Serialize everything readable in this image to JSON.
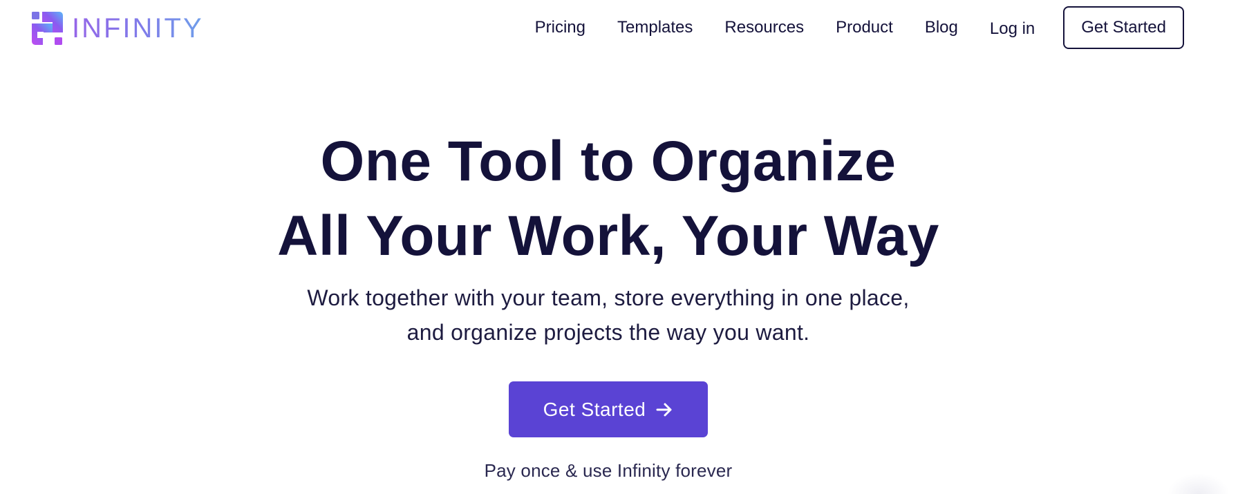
{
  "brand": {
    "name": "INFINITY",
    "icon": "infinity-logo-icon",
    "gradient": [
      "#c04cf0",
      "#8a5cf0",
      "#5ab8f8"
    ]
  },
  "nav": {
    "links": [
      {
        "label": "Pricing"
      },
      {
        "label": "Templates"
      },
      {
        "label": "Resources"
      },
      {
        "label": "Product"
      },
      {
        "label": "Blog"
      }
    ],
    "login_label": "Log in",
    "cta_label": "Get Started"
  },
  "hero": {
    "title_lines": [
      "One Tool to Organize",
      "All Your Work, Your Way"
    ],
    "subtitle_lines": [
      "Work together with your team, store everything in one place,",
      "and organize projects the way you want."
    ],
    "cta_label": "Get Started",
    "cta_icon": "arrow-right-icon",
    "note": "Pay once & use Infinity forever"
  },
  "colors": {
    "text_dark": "#14123a",
    "primary": "#5a43d4",
    "background": "#ffffff"
  }
}
